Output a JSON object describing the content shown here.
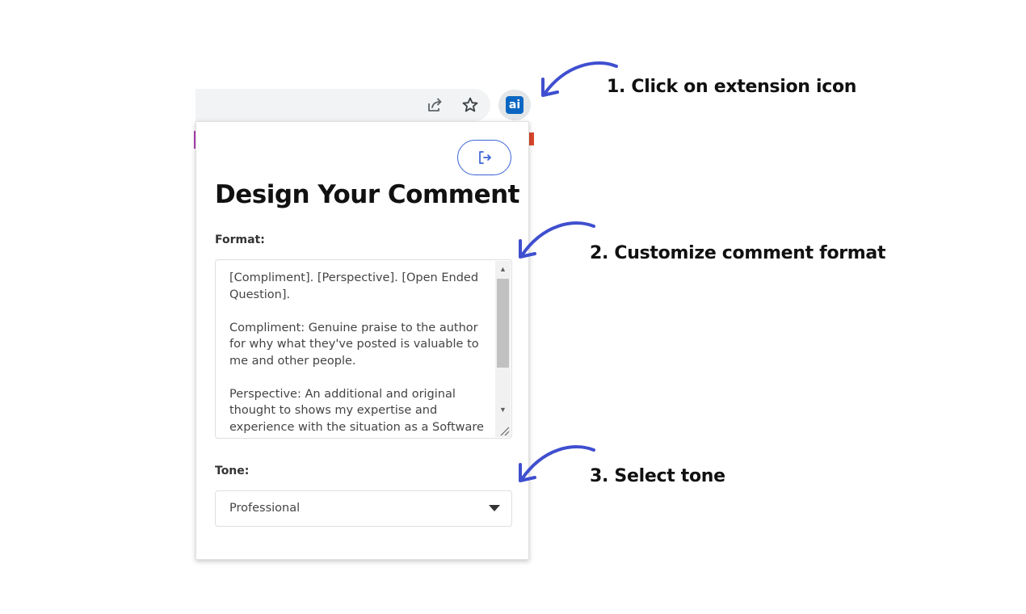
{
  "toolbar": {
    "icons": [
      "share-icon",
      "star-icon"
    ],
    "extension_label": "ai",
    "extension_color": "#0a66c2"
  },
  "popup": {
    "logout_icon": "logout-icon",
    "title": "Design Your Comment",
    "format_label": "Format:",
    "format_value": "[Compliment]. [Perspective]. [Open Ended Question].\n\nCompliment: Genuine praise to the author for why what they've posted is valuable to me and other people.\n\nPerspective: An additional and original thought to shows my expertise and experience with the situation as a Software",
    "tone_label": "Tone:",
    "tone_value": "Professional",
    "accent_color": "#3b64d4"
  },
  "annotations": [
    {
      "text": "1. Click on extension icon"
    },
    {
      "text": "2. Customize comment format"
    },
    {
      "text": "3. Select tone"
    }
  ],
  "arrow_color": "#3f4fcf"
}
